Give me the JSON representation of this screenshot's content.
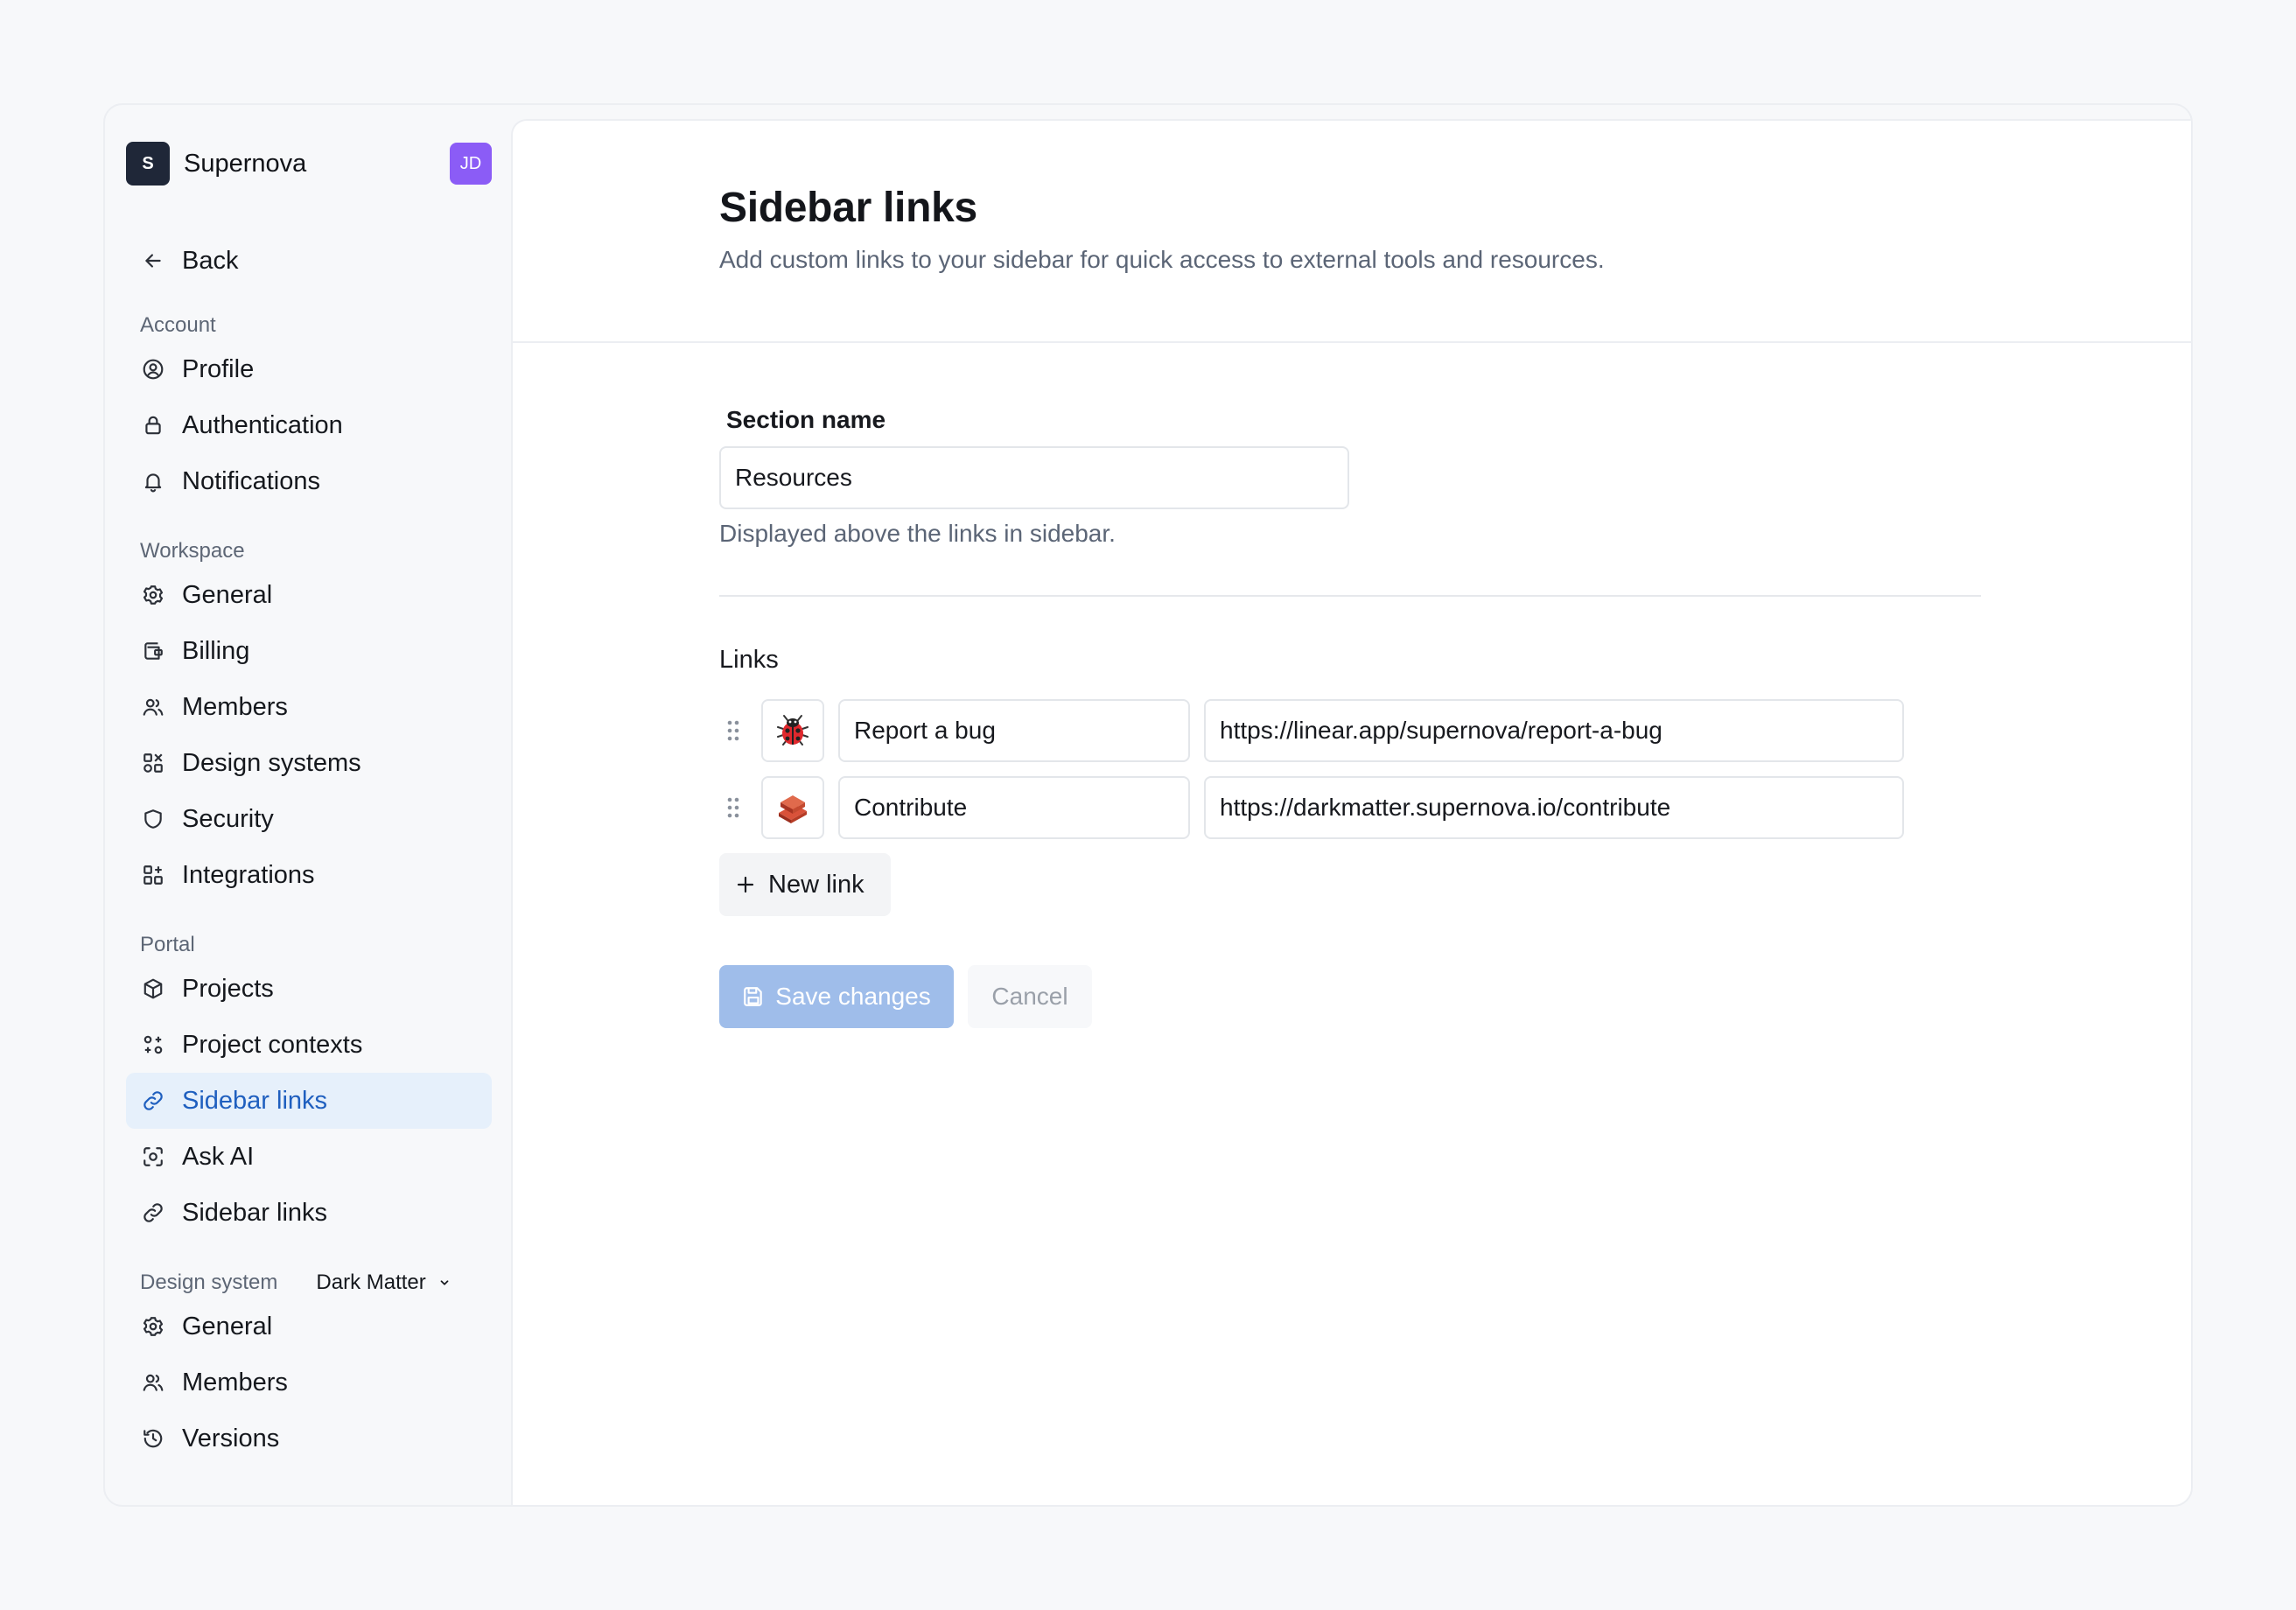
{
  "workspace": {
    "logo_letter": "S",
    "name": "Supernova",
    "avatar_initials": "JD"
  },
  "nav": {
    "back_label": "Back",
    "account": {
      "label": "Account",
      "items": [
        "Profile",
        "Authentication",
        "Notifications"
      ]
    },
    "workspace": {
      "label": "Workspace",
      "items": [
        "General",
        "Billing",
        "Members",
        "Design systems",
        "Security",
        "Integrations"
      ]
    },
    "portal": {
      "label": "Portal",
      "items": [
        "Projects",
        "Project contexts",
        "Sidebar links",
        "Ask AI",
        "Sidebar links"
      ],
      "active_index": 2
    },
    "design_system": {
      "label": "Design system",
      "selected": "Dark Matter",
      "items": [
        "General",
        "Members",
        "Versions"
      ]
    }
  },
  "page": {
    "title": "Sidebar links",
    "subtitle": "Add custom links to your sidebar for quick access to external tools and resources."
  },
  "form": {
    "section_name_label": "Section name",
    "section_name_value": "Resources",
    "section_name_hint": "Displayed above the links in sidebar.",
    "links_label": "Links",
    "links": [
      {
        "icon": "ladybug-emoji",
        "name": "Report a bug",
        "url": "https://linear.app/supernova/report-a-bug"
      },
      {
        "icon": "brick-emoji",
        "name": "Contribute",
        "url": "https://darkmatter.supernova.io/contribute"
      }
    ],
    "new_link_label": "New link",
    "save_label": "Save changes",
    "cancel_label": "Cancel"
  },
  "colors": {
    "accent": "#1f5fbf",
    "active_bg": "#e6f0fb",
    "save_button": "#9fbdea",
    "avatar": "#8b5cf6",
    "logo": "#1f2738"
  }
}
